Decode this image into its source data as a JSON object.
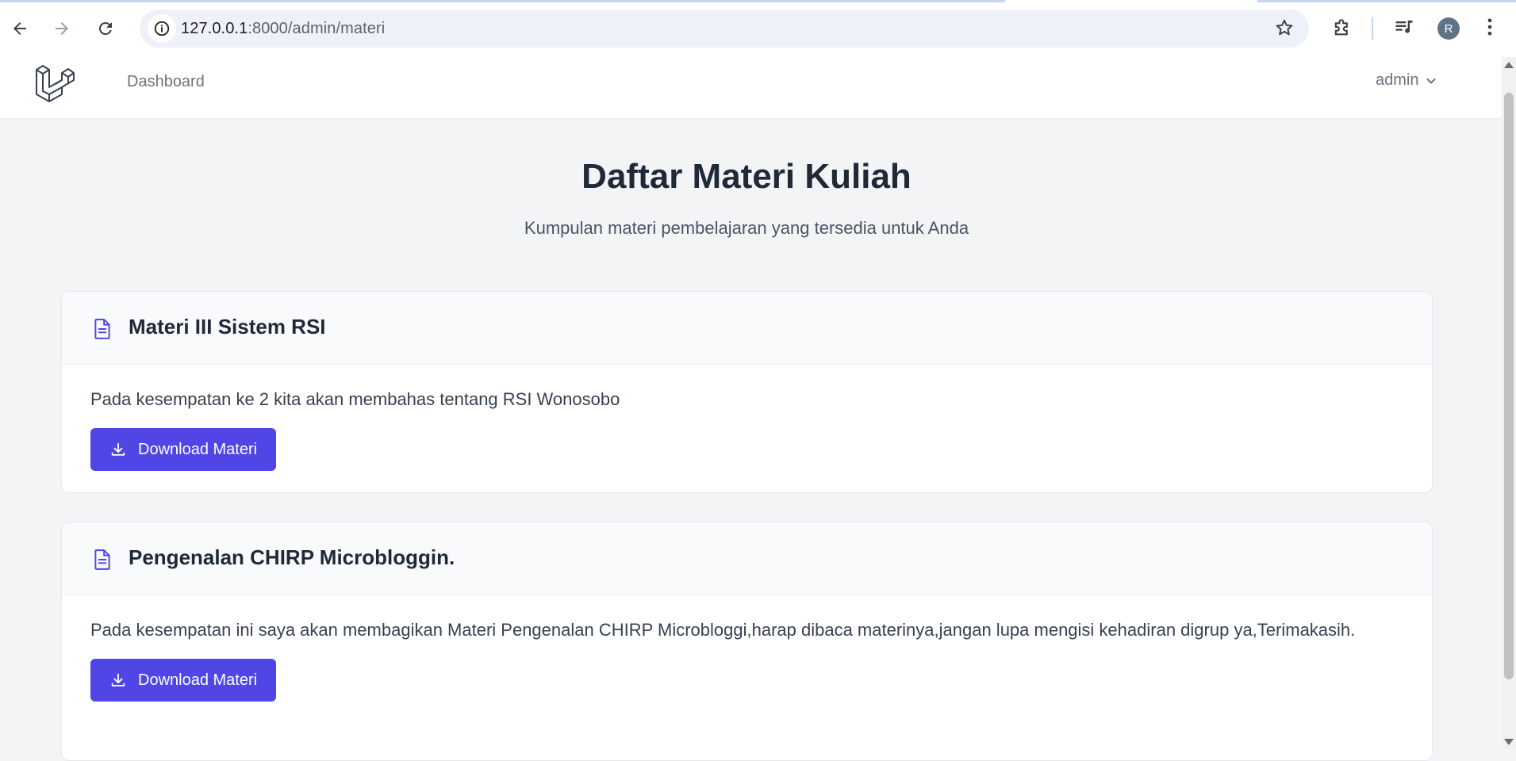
{
  "browser": {
    "url_host": "127.0.0.1",
    "url_rest": ":8000/admin/materi",
    "profile_initial": "R"
  },
  "nav": {
    "dashboard_label": "Dashboard",
    "user_label": "admin"
  },
  "page": {
    "title": "Daftar Materi Kuliah",
    "subtitle": "Kumpulan materi pembelajaran yang tersedia untuk Anda"
  },
  "materi": [
    {
      "title": "Materi III Sistem RSI",
      "description": "Pada kesempatan ke 2 kita akan membahas tentang RSI Wonosobo",
      "button_label": "Download Materi"
    },
    {
      "title": "Pengenalan CHIRP Microbloggin.",
      "description": "Pada kesempatan ini saya akan membagikan Materi Pengenalan CHIRP Microbloggi,harap dibaca materinya,jangan lupa mengisi kehadiran digrup ya,Terimakasih.",
      "button_label": "Download Materi"
    }
  ],
  "colors": {
    "accent": "#4f46e5",
    "page_bg": "#f3f4f6"
  }
}
